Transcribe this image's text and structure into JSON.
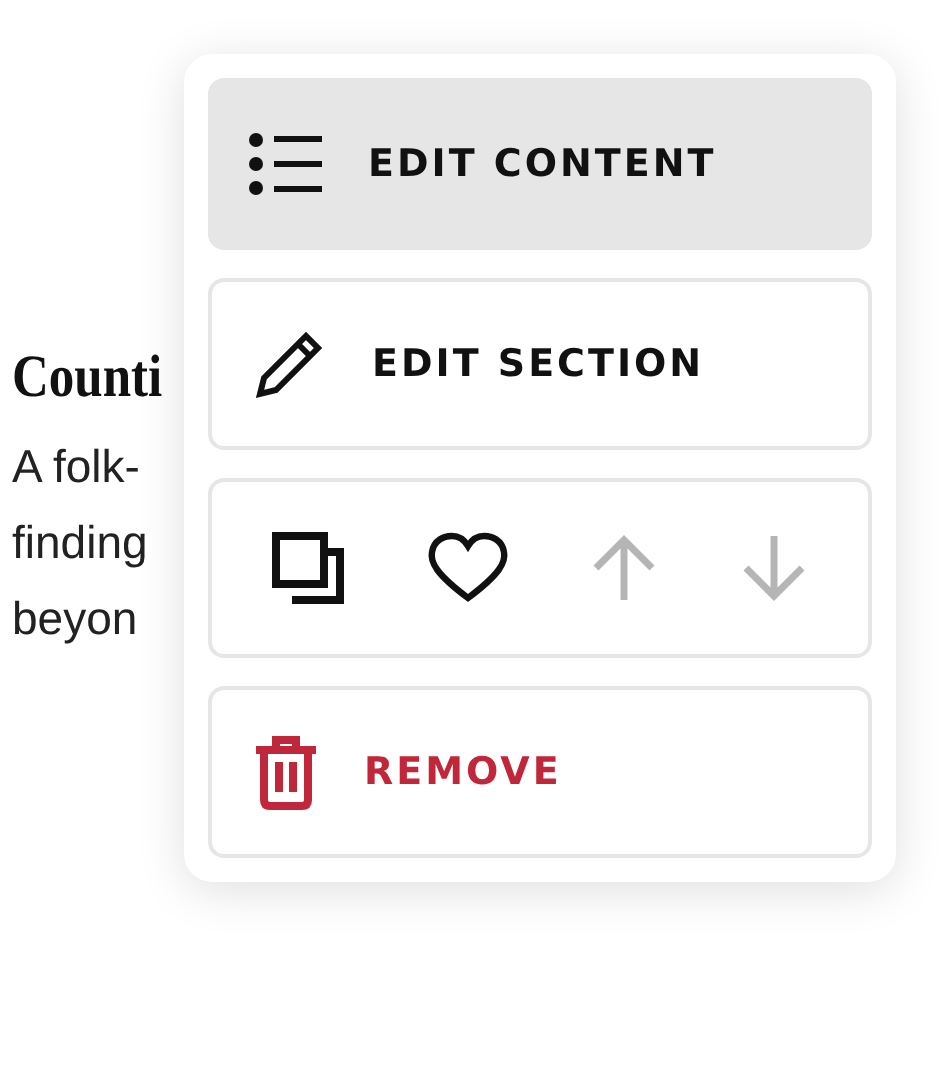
{
  "article": {
    "heading": "Counti",
    "lines": [
      "A folk-",
      "finding",
      "beyon"
    ]
  },
  "menu": {
    "items": [
      {
        "kind": "action",
        "label": "EDIT CONTENT",
        "selected": true
      },
      {
        "kind": "action",
        "label": "EDIT SECTION",
        "selected": false
      },
      {
        "kind": "icons",
        "buttons": [
          {
            "disabled": false
          },
          {
            "disabled": false
          },
          {
            "disabled": true
          },
          {
            "disabled": true
          }
        ]
      },
      {
        "kind": "danger",
        "label": "REMOVE",
        "selected": false
      }
    ]
  }
}
